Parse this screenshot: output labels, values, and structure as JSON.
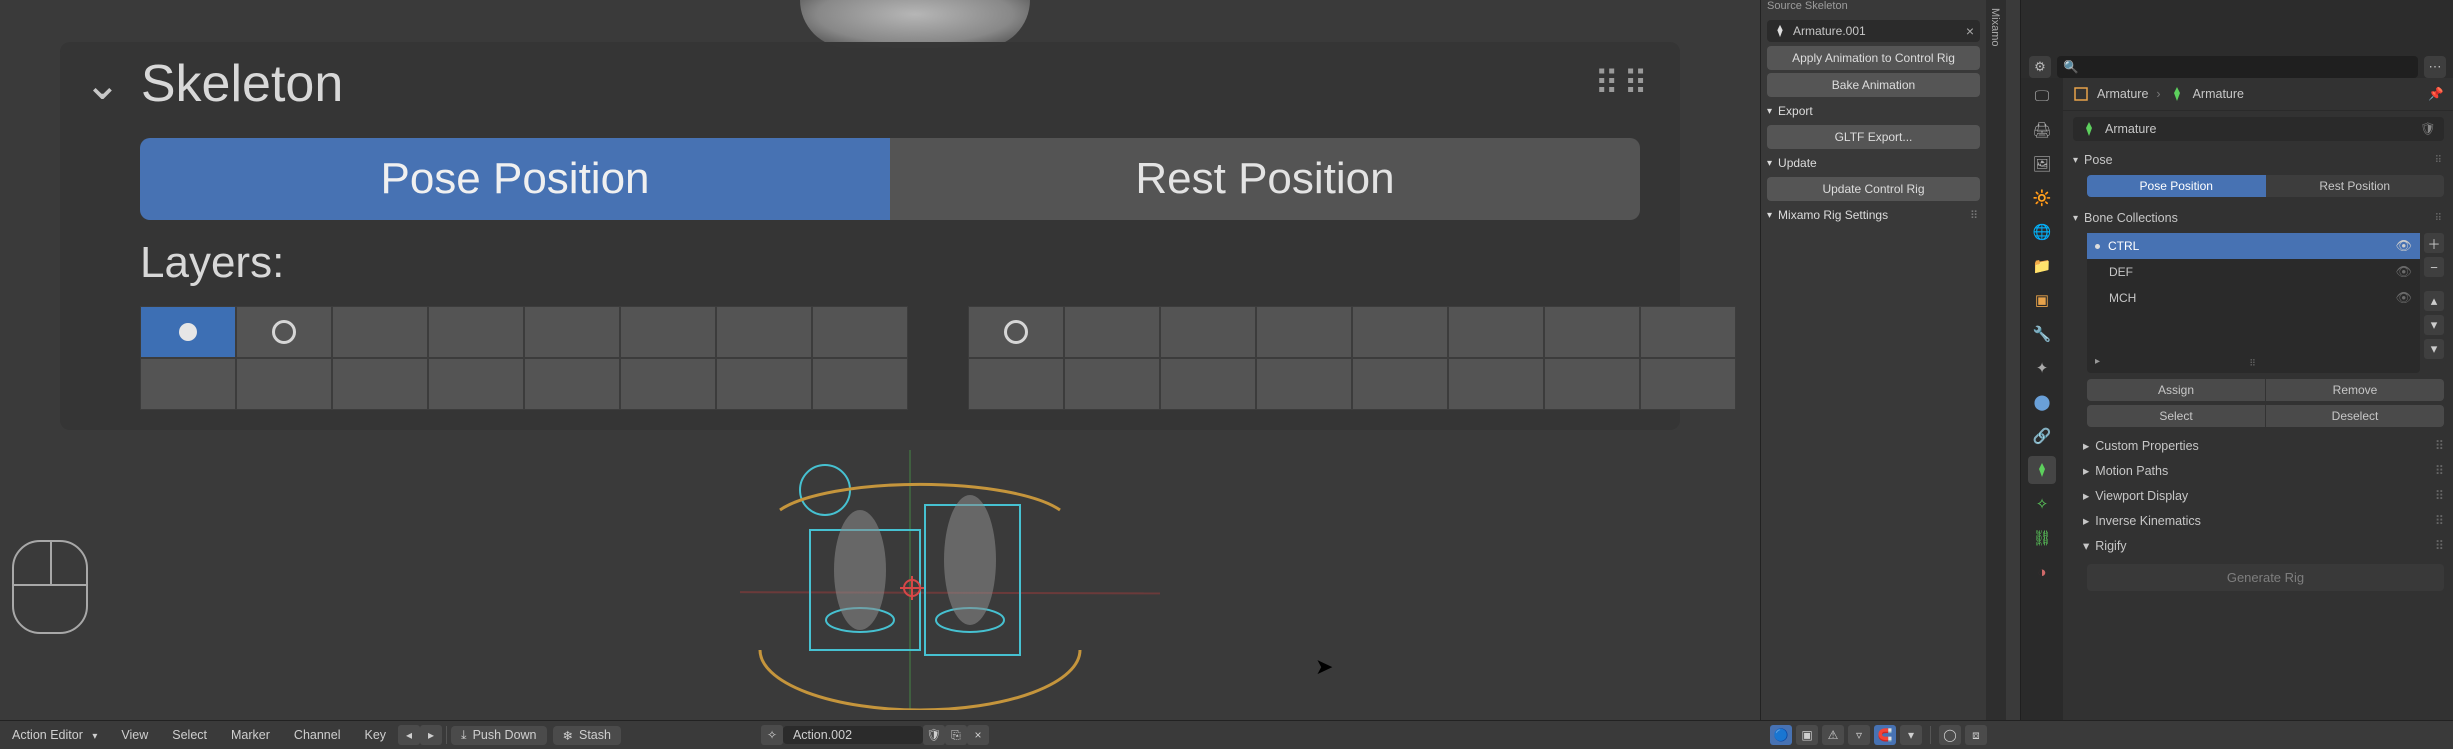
{
  "viewport_panel": {
    "title": "Skeleton",
    "tab_pose": "Pose Position",
    "tab_rest": "Rest Position",
    "layers_label": "Layers:"
  },
  "npanel": {
    "source_skeleton_section": "Source Skeleton",
    "armature_field": "Armature.001",
    "apply_btn": "Apply Animation to Control Rig",
    "bake_btn": "Bake Animation",
    "export_section": "Export",
    "gltf_btn": "GLTF Export...",
    "update_section": "Update",
    "update_btn": "Update Control Rig",
    "mixamo_section": "Mixamo Rig Settings",
    "side_tab": "Mixamo"
  },
  "properties": {
    "breadcrumb_a": "Armature",
    "breadcrumb_b": "Armature",
    "name_field": "Armature",
    "panel_pose": "Pose",
    "pose_position": "Pose Position",
    "rest_position": "Rest Position",
    "panel_bone_collections": "Bone Collections",
    "collections": [
      {
        "name": "CTRL",
        "active": true,
        "eye": true
      },
      {
        "name": "DEF",
        "active": false,
        "eye": true
      },
      {
        "name": "MCH",
        "active": false,
        "eye": true
      }
    ],
    "assign": "Assign",
    "remove": "Remove",
    "select": "Select",
    "deselect": "Deselect",
    "panel_custom_props": "Custom Properties",
    "panel_motion_paths": "Motion Paths",
    "panel_viewport_display": "Viewport Display",
    "panel_ik": "Inverse Kinematics",
    "panel_rigify": "Rigify",
    "generate_btn": "Generate Rig"
  },
  "action_bar": {
    "editor": "Action Editor",
    "menus": [
      "View",
      "Select",
      "Marker",
      "Channel",
      "Key"
    ],
    "push_down": "Push Down",
    "stash": "Stash",
    "action_name": "Action.002"
  }
}
